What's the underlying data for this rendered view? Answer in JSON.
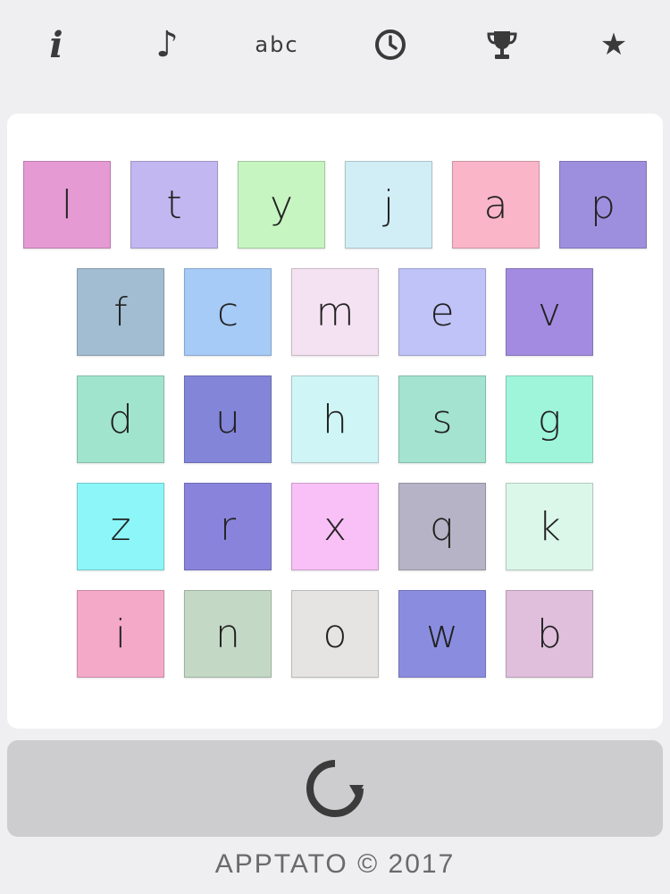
{
  "toolbar": {
    "info_glyph": "i",
    "music_glyph": "♪",
    "abc_label": "abc",
    "star_glyph": "★",
    "icons": [
      "info-icon",
      "music-note-icon",
      "abc-mode",
      "clock-icon",
      "trophy-icon",
      "star-icon"
    ],
    "icon_color": "#3a3a3a"
  },
  "board": {
    "rows": [
      [
        {
          "letter": "l",
          "color": "#e59ad3"
        },
        {
          "letter": "t",
          "color": "#c2b7f0"
        },
        {
          "letter": "y",
          "color": "#c6f5c1"
        },
        {
          "letter": "j",
          "color": "#d1eef6"
        },
        {
          "letter": "a",
          "color": "#fab5c8"
        },
        {
          "letter": "p",
          "color": "#9e8fde"
        }
      ],
      [
        {
          "letter": "f",
          "color": "#a2bdd1"
        },
        {
          "letter": "c",
          "color": "#a6cbf7"
        },
        {
          "letter": "m",
          "color": "#f4e2f3"
        },
        {
          "letter": "e",
          "color": "#c0c3f7"
        },
        {
          "letter": "v",
          "color": "#a28be0"
        }
      ],
      [
        {
          "letter": "d",
          "color": "#a1e4cd"
        },
        {
          "letter": "u",
          "color": "#8385d9"
        },
        {
          "letter": "h",
          "color": "#d0f5f6"
        },
        {
          "letter": "s",
          "color": "#a3e3d0"
        },
        {
          "letter": "g",
          "color": "#9ff5d9"
        }
      ],
      [
        {
          "letter": "z",
          "color": "#8cf6f8"
        },
        {
          "letter": "r",
          "color": "#8a83dc"
        },
        {
          "letter": "x",
          "color": "#f8c0f6"
        },
        {
          "letter": "q",
          "color": "#b5b3c5"
        },
        {
          "letter": "k",
          "color": "#dbf7ea"
        }
      ],
      [
        {
          "letter": "i",
          "color": "#f5a9c8"
        },
        {
          "letter": "n",
          "color": "#c4d8c6"
        },
        {
          "letter": "o",
          "color": "#e5e4e2"
        },
        {
          "letter": "w",
          "color": "#8a8ddf"
        },
        {
          "letter": "b",
          "color": "#e0bfdd"
        }
      ]
    ]
  },
  "refresh": {
    "icon": "refresh-icon",
    "icon_color": "#3b3b3b"
  },
  "footer": {
    "text": "APPTATO © 2017"
  }
}
